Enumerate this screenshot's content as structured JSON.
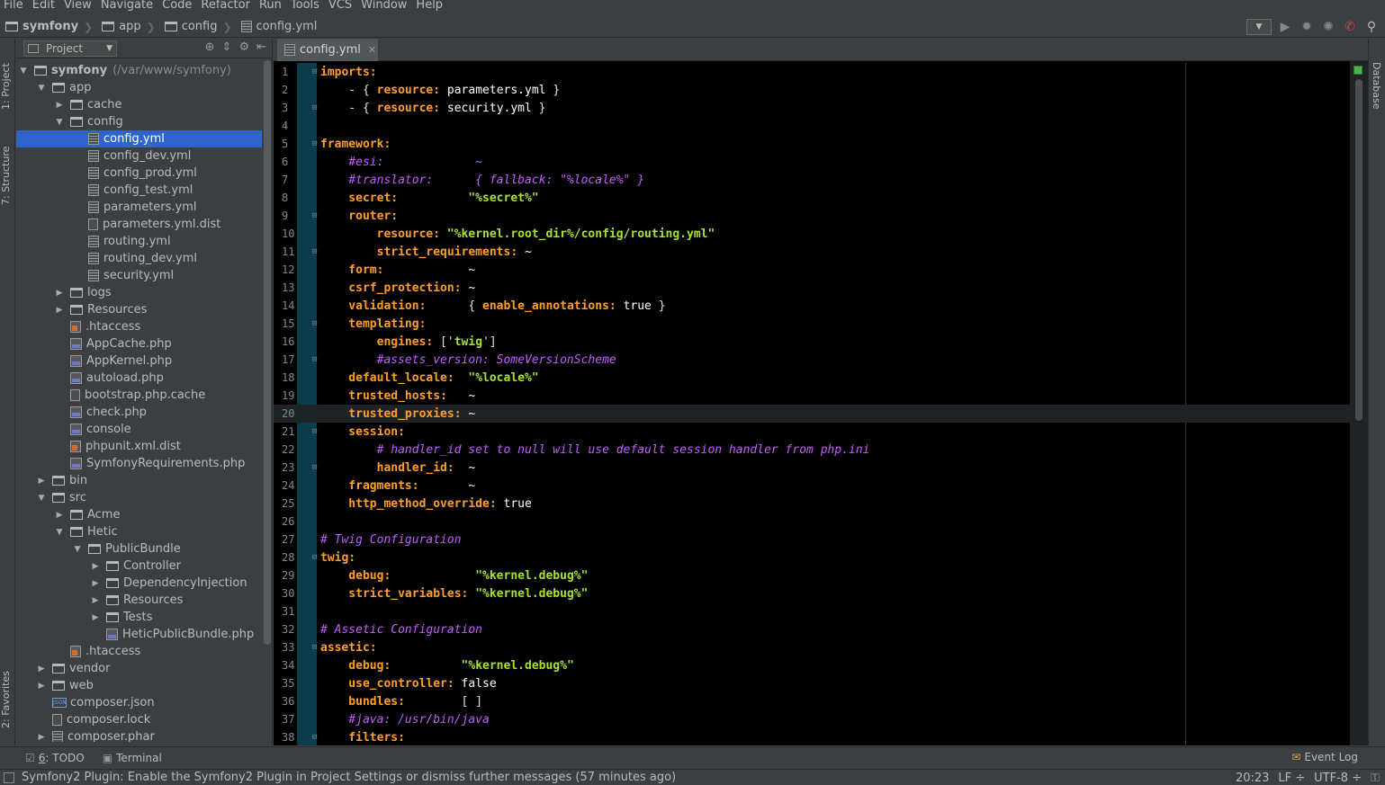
{
  "menu": [
    "File",
    "Edit",
    "View",
    "Navigate",
    "Code",
    "Refactor",
    "Run",
    "Tools",
    "VCS",
    "Window",
    "Help"
  ],
  "breadcrumb": [
    "symfony",
    "app",
    "config",
    "config.yml"
  ],
  "left_tools": {
    "project": "1: Project",
    "structure": "7: Structure",
    "favorites": "2: Favorites"
  },
  "right_tools": {
    "database": "Database"
  },
  "project_panel": {
    "view_label": "Project",
    "tree": [
      {
        "label": "symfony",
        "sub": "(/var/www/symfony)",
        "depth": 0,
        "arrow": "open",
        "icon": "folder",
        "bold": true
      },
      {
        "label": "app",
        "depth": 1,
        "arrow": "open",
        "icon": "folder"
      },
      {
        "label": "cache",
        "depth": 2,
        "arrow": "closed",
        "icon": "folder"
      },
      {
        "label": "config",
        "depth": 2,
        "arrow": "open",
        "icon": "folder"
      },
      {
        "label": "config.yml",
        "depth": 3,
        "arrow": "none",
        "icon": "file",
        "selected": true
      },
      {
        "label": "config_dev.yml",
        "depth": 3,
        "arrow": "none",
        "icon": "file"
      },
      {
        "label": "config_prod.yml",
        "depth": 3,
        "arrow": "none",
        "icon": "file"
      },
      {
        "label": "config_test.yml",
        "depth": 3,
        "arrow": "none",
        "icon": "file"
      },
      {
        "label": "parameters.yml",
        "depth": 3,
        "arrow": "none",
        "icon": "file"
      },
      {
        "label": "parameters.yml.dist",
        "depth": 3,
        "arrow": "none",
        "icon": "plain"
      },
      {
        "label": "routing.yml",
        "depth": 3,
        "arrow": "none",
        "icon": "file"
      },
      {
        "label": "routing_dev.yml",
        "depth": 3,
        "arrow": "none",
        "icon": "file"
      },
      {
        "label": "security.yml",
        "depth": 3,
        "arrow": "none",
        "icon": "file"
      },
      {
        "label": "logs",
        "depth": 2,
        "arrow": "closed",
        "icon": "folder"
      },
      {
        "label": "Resources",
        "depth": 2,
        "arrow": "closed",
        "icon": "folder"
      },
      {
        "label": ".htaccess",
        "depth": 2,
        "arrow": "none",
        "icon": "htaccess"
      },
      {
        "label": "AppCache.php",
        "depth": 2,
        "arrow": "none",
        "icon": "php"
      },
      {
        "label": "AppKernel.php",
        "depth": 2,
        "arrow": "none",
        "icon": "php"
      },
      {
        "label": "autoload.php",
        "depth": 2,
        "arrow": "none",
        "icon": "php"
      },
      {
        "label": "bootstrap.php.cache",
        "depth": 2,
        "arrow": "none",
        "icon": "plain"
      },
      {
        "label": "check.php",
        "depth": 2,
        "arrow": "none",
        "icon": "php"
      },
      {
        "label": "console",
        "depth": 2,
        "arrow": "none",
        "icon": "php"
      },
      {
        "label": "phpunit.xml.dist",
        "depth": 2,
        "arrow": "none",
        "icon": "htaccess"
      },
      {
        "label": "SymfonyRequirements.php",
        "depth": 2,
        "arrow": "none",
        "icon": "php"
      },
      {
        "label": "bin",
        "depth": 1,
        "arrow": "closed",
        "icon": "folder"
      },
      {
        "label": "src",
        "depth": 1,
        "arrow": "open",
        "icon": "folder"
      },
      {
        "label": "Acme",
        "depth": 2,
        "arrow": "closed",
        "icon": "folder"
      },
      {
        "label": "Hetic",
        "depth": 2,
        "arrow": "open",
        "icon": "folder"
      },
      {
        "label": "PublicBundle",
        "depth": 3,
        "arrow": "open",
        "icon": "folder"
      },
      {
        "label": "Controller",
        "depth": 4,
        "arrow": "closed",
        "icon": "folder"
      },
      {
        "label": "DependencyInjection",
        "depth": 4,
        "arrow": "closed",
        "icon": "folder"
      },
      {
        "label": "Resources",
        "depth": 4,
        "arrow": "closed",
        "icon": "folder"
      },
      {
        "label": "Tests",
        "depth": 4,
        "arrow": "closed",
        "icon": "folder"
      },
      {
        "label": "HeticPublicBundle.php",
        "depth": 4,
        "arrow": "none",
        "icon": "php"
      },
      {
        "label": ".htaccess",
        "depth": 2,
        "arrow": "none",
        "icon": "htaccess"
      },
      {
        "label": "vendor",
        "depth": 1,
        "arrow": "closed",
        "icon": "folder"
      },
      {
        "label": "web",
        "depth": 1,
        "arrow": "closed",
        "icon": "folder"
      },
      {
        "label": "composer.json",
        "depth": 1,
        "arrow": "none",
        "icon": "json"
      },
      {
        "label": "composer.lock",
        "depth": 1,
        "arrow": "none",
        "icon": "plain"
      },
      {
        "label": "composer.phar",
        "depth": 1,
        "arrow": "closed",
        "icon": "file"
      }
    ]
  },
  "editor": {
    "tab": "config.yml",
    "current_line": 20,
    "lines": [
      [
        [
          "k",
          "imports:"
        ]
      ],
      [
        [
          "p",
          "    - { "
        ],
        [
          "k",
          "resource:"
        ],
        [
          "v",
          " parameters.yml "
        ],
        [
          "p",
          "}"
        ]
      ],
      [
        [
          "p",
          "    - { "
        ],
        [
          "k",
          "resource:"
        ],
        [
          "v",
          " security.yml "
        ],
        [
          "p",
          "}"
        ]
      ],
      [],
      [
        [
          "k",
          "framework:"
        ]
      ],
      [
        [
          "c",
          "    #esi:             ~"
        ]
      ],
      [
        [
          "c",
          "    #translator:      { fallback: \"%locale%\" }"
        ]
      ],
      [
        [
          "k",
          "    secret:"
        ],
        [
          "s",
          "          \"%secret%\""
        ]
      ],
      [
        [
          "k",
          "    router:"
        ]
      ],
      [
        [
          "k",
          "        resource:"
        ],
        [
          "s",
          " \"%kernel.root_dir%/config/routing.yml\""
        ]
      ],
      [
        [
          "k",
          "        strict_requirements:"
        ],
        [
          "v",
          " ~"
        ]
      ],
      [
        [
          "k",
          "    form:"
        ],
        [
          "v",
          "            ~"
        ]
      ],
      [
        [
          "k",
          "    csrf_protection:"
        ],
        [
          "v",
          " ~"
        ]
      ],
      [
        [
          "k",
          "    validation:"
        ],
        [
          "p",
          "      { "
        ],
        [
          "k",
          "enable_annotations:"
        ],
        [
          "v",
          " true "
        ],
        [
          "p",
          "}"
        ]
      ],
      [
        [
          "k",
          "    templating:"
        ]
      ],
      [
        [
          "k",
          "        engines:"
        ],
        [
          "p",
          " ['"
        ],
        [
          "s",
          "twig"
        ],
        [
          "p",
          "']"
        ]
      ],
      [
        [
          "c",
          "        #assets_version: SomeVersionScheme"
        ]
      ],
      [
        [
          "k",
          "    default_locale:"
        ],
        [
          "s",
          "  \"%locale%\""
        ]
      ],
      [
        [
          "k",
          "    trusted_hosts:"
        ],
        [
          "v",
          "   ~"
        ]
      ],
      [
        [
          "k",
          "    trusted_proxies:"
        ],
        [
          "v",
          " ~"
        ]
      ],
      [
        [
          "k",
          "    session:"
        ]
      ],
      [
        [
          "c",
          "        # handler_id set to null will use default session handler from php.ini"
        ]
      ],
      [
        [
          "k",
          "        handler_id:"
        ],
        [
          "v",
          "  ~"
        ]
      ],
      [
        [
          "k",
          "    fragments:"
        ],
        [
          "v",
          "       ~"
        ]
      ],
      [
        [
          "k",
          "    http_method_override:"
        ],
        [
          "v",
          " true"
        ]
      ],
      [],
      [
        [
          "c",
          "# Twig Configuration"
        ]
      ],
      [
        [
          "k",
          "twig:"
        ]
      ],
      [
        [
          "k",
          "    debug:"
        ],
        [
          "s",
          "            \"%kernel.debug%\""
        ]
      ],
      [
        [
          "k",
          "    strict_variables:"
        ],
        [
          "s",
          " \"%kernel.debug%\""
        ]
      ],
      [],
      [
        [
          "c",
          "# Assetic Configuration"
        ]
      ],
      [
        [
          "k",
          "assetic:"
        ]
      ],
      [
        [
          "k",
          "    debug:"
        ],
        [
          "s",
          "          \"%kernel.debug%\""
        ]
      ],
      [
        [
          "k",
          "    use_controller:"
        ],
        [
          "v",
          " false"
        ]
      ],
      [
        [
          "k",
          "    bundles:"
        ],
        [
          "p",
          "        [ ]"
        ]
      ],
      [
        [
          "c",
          "    #java: /usr/bin/java"
        ]
      ],
      [
        [
          "k",
          "    filters:"
        ]
      ]
    ],
    "fold_lines": [
      1,
      3,
      5,
      9,
      11,
      15,
      17,
      21,
      23,
      28,
      33,
      38
    ]
  },
  "bottom_tools": {
    "todo_num": "6",
    "todo_label": ": TODO",
    "terminal": "Terminal",
    "event_log": "Event Log"
  },
  "status": {
    "message": "Symfony2 Plugin: Enable the Symfony2 Plugin in Project Settings or dismiss further messages (57 minutes ago)",
    "position": "20:23",
    "line_sep": "LF ÷",
    "encoding": "UTF-8 ÷"
  },
  "colors": {
    "keyword": "#ff9f2a",
    "string": "#a6e22e",
    "comment": "#c35cff",
    "selection": "#2f65ca",
    "gutter_fold": "#0a3c4c"
  }
}
